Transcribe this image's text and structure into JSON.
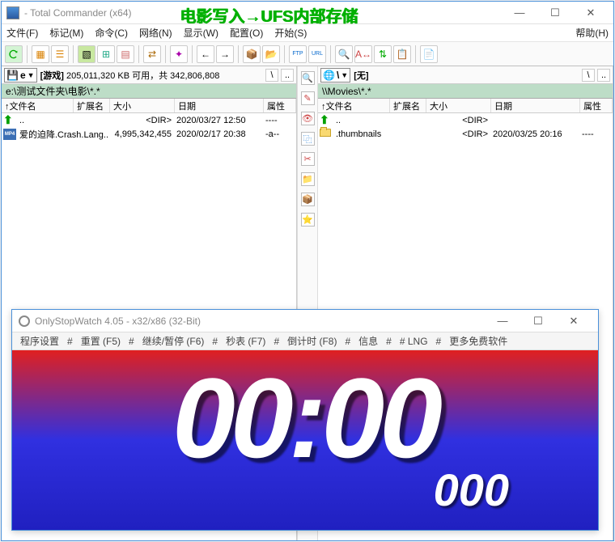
{
  "tc": {
    "title": " - Total Commander (x64)",
    "overlay": "电影写入→UFS内部存储",
    "menu": {
      "file": "文件(F)",
      "mark": "标记(M)",
      "cmd": "命令(C)",
      "net": "网络(N)",
      "show": "显示(W)",
      "cfg": "配置(O)",
      "start": "开始(S)",
      "help": "帮助(H)"
    },
    "winctrl": {
      "min": "—",
      "max": "☐",
      "close": "✕"
    }
  },
  "left": {
    "drive": "e",
    "drive_label": "[游戏]",
    "free": "205,011,320 KB 可用，共 342,806,808",
    "path": "e:\\测试文件夹\\电影\\*.*",
    "cols": {
      "name": "↑文件名",
      "ext": "扩展名",
      "size": "大小",
      "date": "日期",
      "attr": "属性"
    },
    "rows": [
      {
        "name": "..",
        "size": "<DIR>",
        "date": "2020/03/27 12:50",
        "attr": "----",
        "folder": true,
        "up": true
      },
      {
        "name": "爱的迫降.Crash.Lang..",
        "size": "4,995,342,455",
        "date": "2020/02/17 20:38",
        "attr": "-a--",
        "mp4": true
      }
    ]
  },
  "right": {
    "drive": "\\",
    "drive_label": "[无]",
    "path": "\\\\Movies\\*.*",
    "cols": {
      "name": "↑文件名",
      "ext": "扩展名",
      "size": "大小",
      "date": "日期",
      "attr": "属性"
    },
    "rows": [
      {
        "name": "..",
        "size": "<DIR>",
        "date": "",
        "attr": "",
        "folder": true,
        "up": true
      },
      {
        "name": ".thumbnails",
        "size": "<DIR>",
        "date": "2020/03/25 20:16",
        "attr": "----",
        "folder": true
      }
    ]
  },
  "sw": {
    "title": "OnlyStopWatch 4.05 - x32/x86 (32-Bit)",
    "menu": [
      "程序设置",
      "#",
      "重置 (F5)",
      "#",
      "继续/暂停 (F6)",
      "#",
      "秒表 (F7)",
      "#",
      "倒计时 (F8)",
      "#",
      "信息",
      "#",
      "# LNG",
      "#",
      "更多免费软件"
    ],
    "main": "00:00",
    "ms": "000"
  }
}
